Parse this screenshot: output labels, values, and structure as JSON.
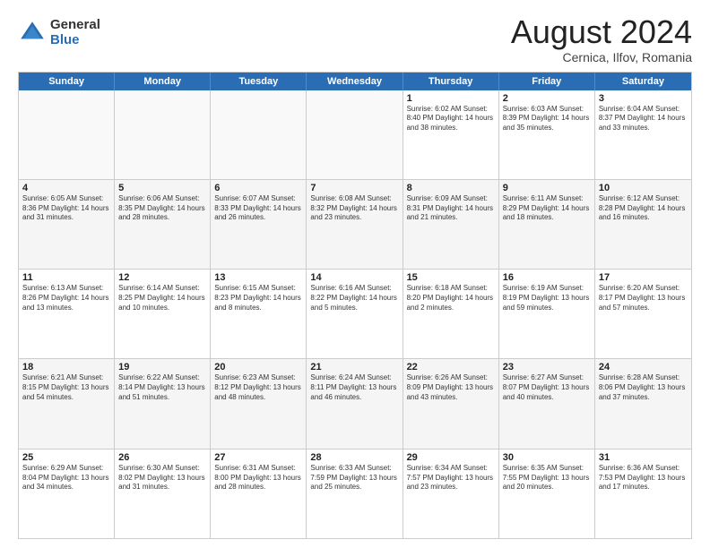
{
  "logo": {
    "general": "General",
    "blue": "Blue"
  },
  "title": "August 2024",
  "location": "Cernica, Ilfov, Romania",
  "days_of_week": [
    "Sunday",
    "Monday",
    "Tuesday",
    "Wednesday",
    "Thursday",
    "Friday",
    "Saturday"
  ],
  "rows": [
    [
      {
        "day": "",
        "info": "",
        "empty": true
      },
      {
        "day": "",
        "info": "",
        "empty": true
      },
      {
        "day": "",
        "info": "",
        "empty": true
      },
      {
        "day": "",
        "info": "",
        "empty": true
      },
      {
        "day": "1",
        "info": "Sunrise: 6:02 AM\nSunset: 8:40 PM\nDaylight: 14 hours\nand 38 minutes."
      },
      {
        "day": "2",
        "info": "Sunrise: 6:03 AM\nSunset: 8:39 PM\nDaylight: 14 hours\nand 35 minutes."
      },
      {
        "day": "3",
        "info": "Sunrise: 6:04 AM\nSunset: 8:37 PM\nDaylight: 14 hours\nand 33 minutes."
      }
    ],
    [
      {
        "day": "4",
        "info": "Sunrise: 6:05 AM\nSunset: 8:36 PM\nDaylight: 14 hours\nand 31 minutes."
      },
      {
        "day": "5",
        "info": "Sunrise: 6:06 AM\nSunset: 8:35 PM\nDaylight: 14 hours\nand 28 minutes."
      },
      {
        "day": "6",
        "info": "Sunrise: 6:07 AM\nSunset: 8:33 PM\nDaylight: 14 hours\nand 26 minutes."
      },
      {
        "day": "7",
        "info": "Sunrise: 6:08 AM\nSunset: 8:32 PM\nDaylight: 14 hours\nand 23 minutes."
      },
      {
        "day": "8",
        "info": "Sunrise: 6:09 AM\nSunset: 8:31 PM\nDaylight: 14 hours\nand 21 minutes."
      },
      {
        "day": "9",
        "info": "Sunrise: 6:11 AM\nSunset: 8:29 PM\nDaylight: 14 hours\nand 18 minutes."
      },
      {
        "day": "10",
        "info": "Sunrise: 6:12 AM\nSunset: 8:28 PM\nDaylight: 14 hours\nand 16 minutes."
      }
    ],
    [
      {
        "day": "11",
        "info": "Sunrise: 6:13 AM\nSunset: 8:26 PM\nDaylight: 14 hours\nand 13 minutes."
      },
      {
        "day": "12",
        "info": "Sunrise: 6:14 AM\nSunset: 8:25 PM\nDaylight: 14 hours\nand 10 minutes."
      },
      {
        "day": "13",
        "info": "Sunrise: 6:15 AM\nSunset: 8:23 PM\nDaylight: 14 hours\nand 8 minutes."
      },
      {
        "day": "14",
        "info": "Sunrise: 6:16 AM\nSunset: 8:22 PM\nDaylight: 14 hours\nand 5 minutes."
      },
      {
        "day": "15",
        "info": "Sunrise: 6:18 AM\nSunset: 8:20 PM\nDaylight: 14 hours\nand 2 minutes."
      },
      {
        "day": "16",
        "info": "Sunrise: 6:19 AM\nSunset: 8:19 PM\nDaylight: 13 hours\nand 59 minutes."
      },
      {
        "day": "17",
        "info": "Sunrise: 6:20 AM\nSunset: 8:17 PM\nDaylight: 13 hours\nand 57 minutes."
      }
    ],
    [
      {
        "day": "18",
        "info": "Sunrise: 6:21 AM\nSunset: 8:15 PM\nDaylight: 13 hours\nand 54 minutes."
      },
      {
        "day": "19",
        "info": "Sunrise: 6:22 AM\nSunset: 8:14 PM\nDaylight: 13 hours\nand 51 minutes."
      },
      {
        "day": "20",
        "info": "Sunrise: 6:23 AM\nSunset: 8:12 PM\nDaylight: 13 hours\nand 48 minutes."
      },
      {
        "day": "21",
        "info": "Sunrise: 6:24 AM\nSunset: 8:11 PM\nDaylight: 13 hours\nand 46 minutes."
      },
      {
        "day": "22",
        "info": "Sunrise: 6:26 AM\nSunset: 8:09 PM\nDaylight: 13 hours\nand 43 minutes."
      },
      {
        "day": "23",
        "info": "Sunrise: 6:27 AM\nSunset: 8:07 PM\nDaylight: 13 hours\nand 40 minutes."
      },
      {
        "day": "24",
        "info": "Sunrise: 6:28 AM\nSunset: 8:06 PM\nDaylight: 13 hours\nand 37 minutes."
      }
    ],
    [
      {
        "day": "25",
        "info": "Sunrise: 6:29 AM\nSunset: 8:04 PM\nDaylight: 13 hours\nand 34 minutes."
      },
      {
        "day": "26",
        "info": "Sunrise: 6:30 AM\nSunset: 8:02 PM\nDaylight: 13 hours\nand 31 minutes."
      },
      {
        "day": "27",
        "info": "Sunrise: 6:31 AM\nSunset: 8:00 PM\nDaylight: 13 hours\nand 28 minutes."
      },
      {
        "day": "28",
        "info": "Sunrise: 6:33 AM\nSunset: 7:59 PM\nDaylight: 13 hours\nand 25 minutes."
      },
      {
        "day": "29",
        "info": "Sunrise: 6:34 AM\nSunset: 7:57 PM\nDaylight: 13 hours\nand 23 minutes."
      },
      {
        "day": "30",
        "info": "Sunrise: 6:35 AM\nSunset: 7:55 PM\nDaylight: 13 hours\nand 20 minutes."
      },
      {
        "day": "31",
        "info": "Sunrise: 6:36 AM\nSunset: 7:53 PM\nDaylight: 13 hours\nand 17 minutes."
      }
    ]
  ]
}
